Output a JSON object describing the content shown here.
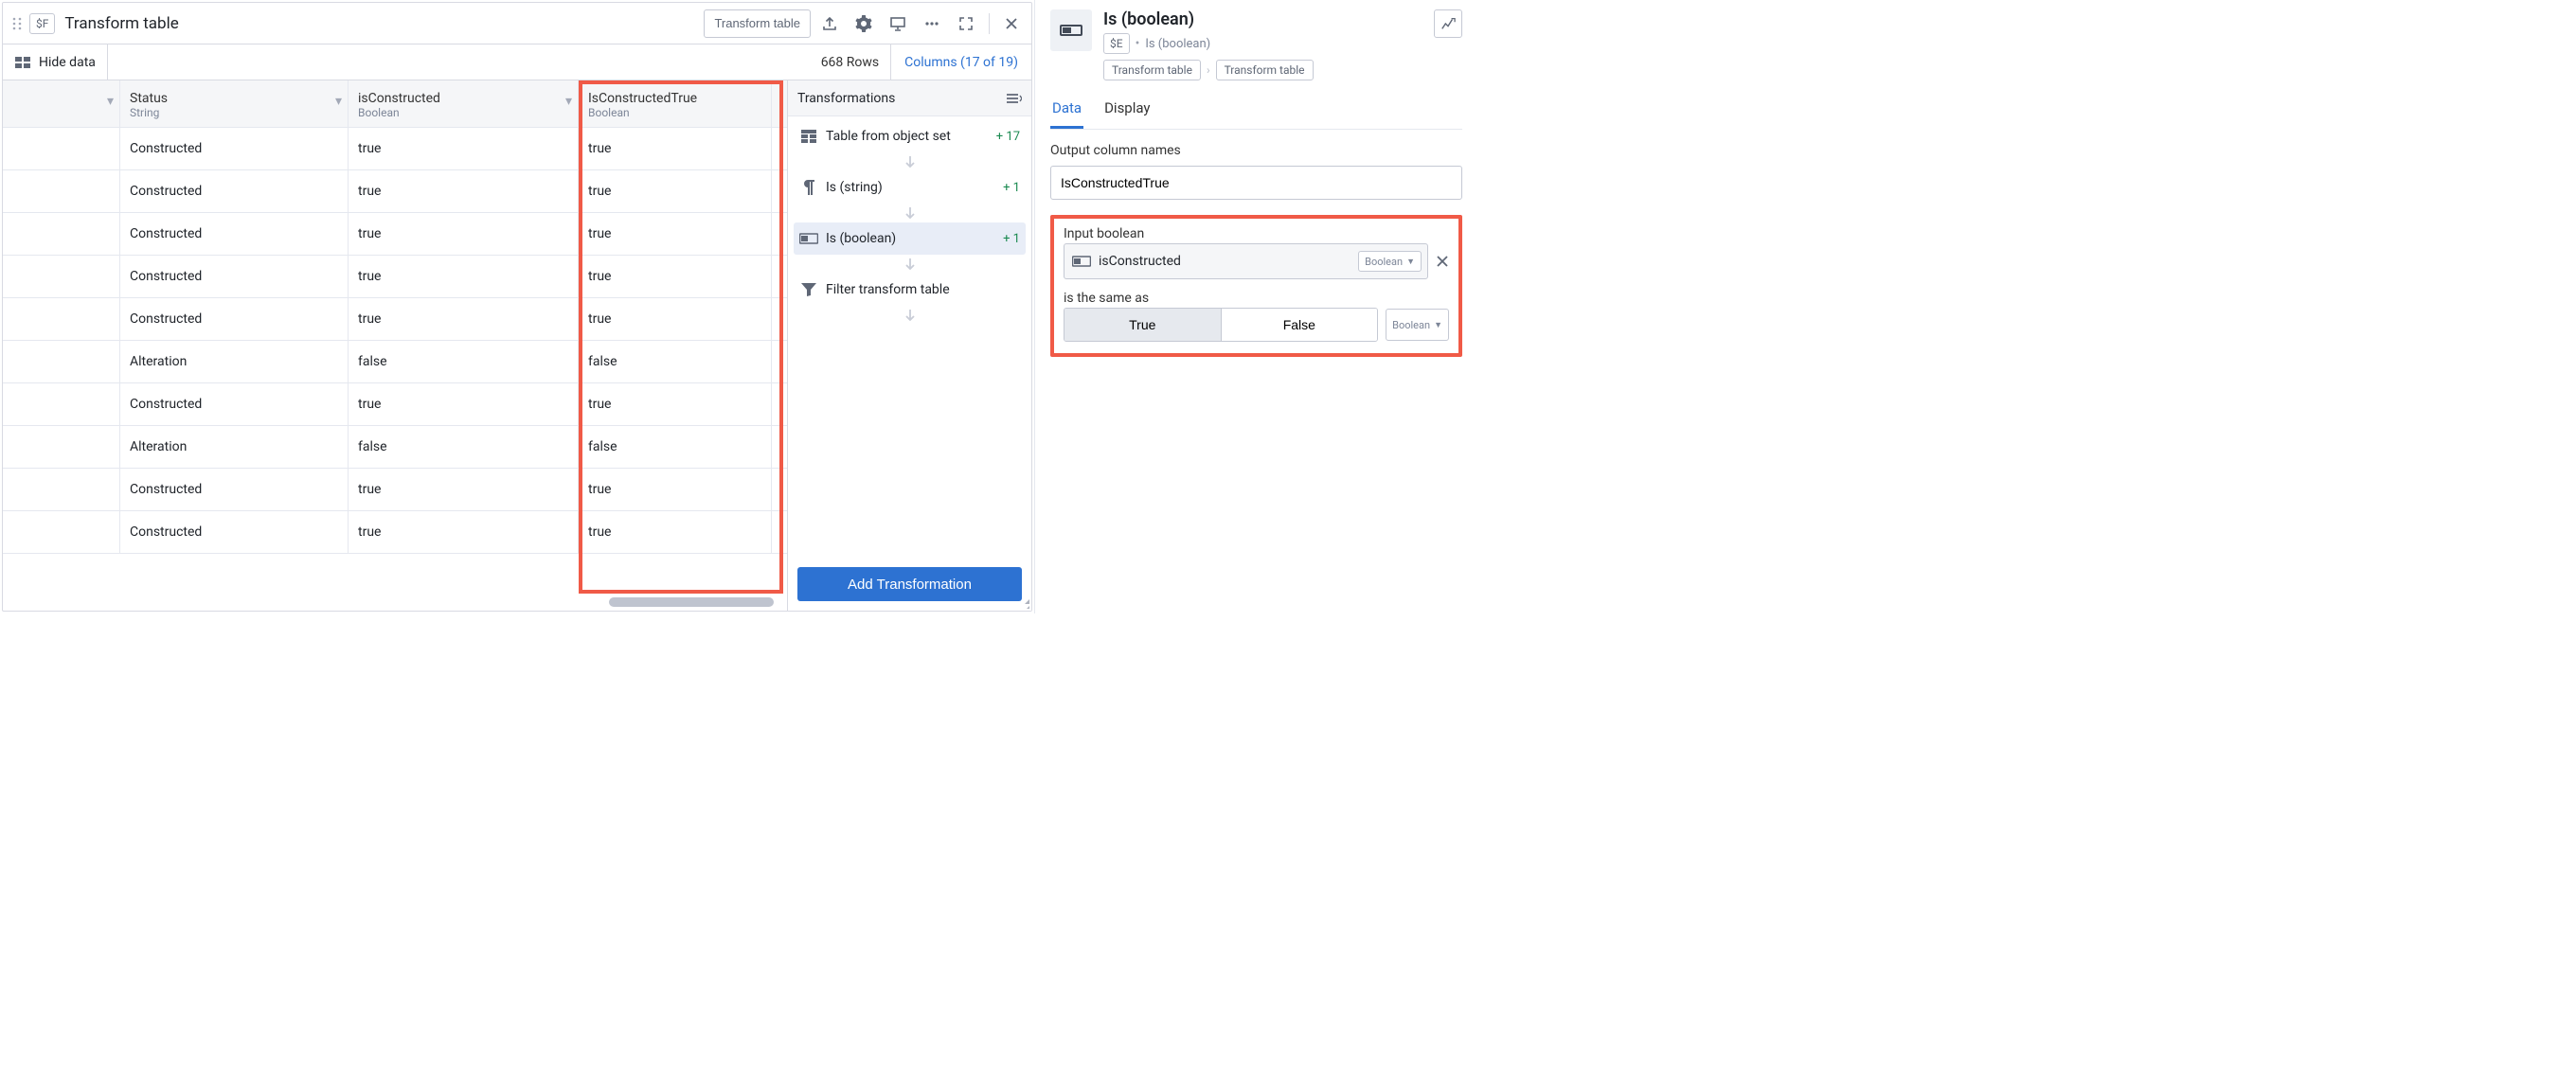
{
  "left": {
    "badge": "$F",
    "title": "Transform table",
    "transform_btn": "Transform table",
    "hide_data": "Hide data",
    "rowcount": "668 Rows",
    "colcount": "Columns (17 of 19)"
  },
  "columns": {
    "status_name": "Status",
    "status_type": "String",
    "isc_name": "isConstructed",
    "isc_type": "Boolean",
    "ict_name": "IsConstructedTrue",
    "ict_type": "Boolean"
  },
  "rows": [
    {
      "status": "Constructed",
      "isc": "true",
      "ict": "true"
    },
    {
      "status": "Constructed",
      "isc": "true",
      "ict": "true"
    },
    {
      "status": "Constructed",
      "isc": "true",
      "ict": "true"
    },
    {
      "status": "Constructed",
      "isc": "true",
      "ict": "true"
    },
    {
      "status": "Constructed",
      "isc": "true",
      "ict": "true"
    },
    {
      "status": "Alteration",
      "isc": "false",
      "ict": "false"
    },
    {
      "status": "Constructed",
      "isc": "true",
      "ict": "true"
    },
    {
      "status": "Alteration",
      "isc": "false",
      "ict": "false"
    },
    {
      "status": "Constructed",
      "isc": "true",
      "ict": "true"
    },
    {
      "status": "Constructed",
      "isc": "true",
      "ict": "true"
    }
  ],
  "tpanel": {
    "title": "Transformations",
    "items": [
      {
        "label": "Table from object set",
        "count": "+ 17",
        "icon": "table"
      },
      {
        "label": "Is (string)",
        "count": "+ 1",
        "icon": "pilcrow"
      },
      {
        "label": "Is (boolean)",
        "count": "+ 1",
        "icon": "bool",
        "selected": true
      },
      {
        "label": "Filter transform table",
        "count": "",
        "icon": "filter"
      }
    ],
    "add_label": "Add Transformation"
  },
  "insp": {
    "title": "Is (boolean)",
    "badge": "$E",
    "sub_label": "Is (boolean)",
    "crumb1": "Transform table",
    "crumb2": "Transform table",
    "tab_data": "Data",
    "tab_display": "Display",
    "out_label": "Output column names",
    "out_value": "IsConstructedTrue",
    "in_label": "Input boolean",
    "in_value": "isConstructed",
    "in_type": "Boolean",
    "cmp_label": "is the same as",
    "true_label": "True",
    "false_label": "False",
    "cmp_type": "Boolean"
  }
}
